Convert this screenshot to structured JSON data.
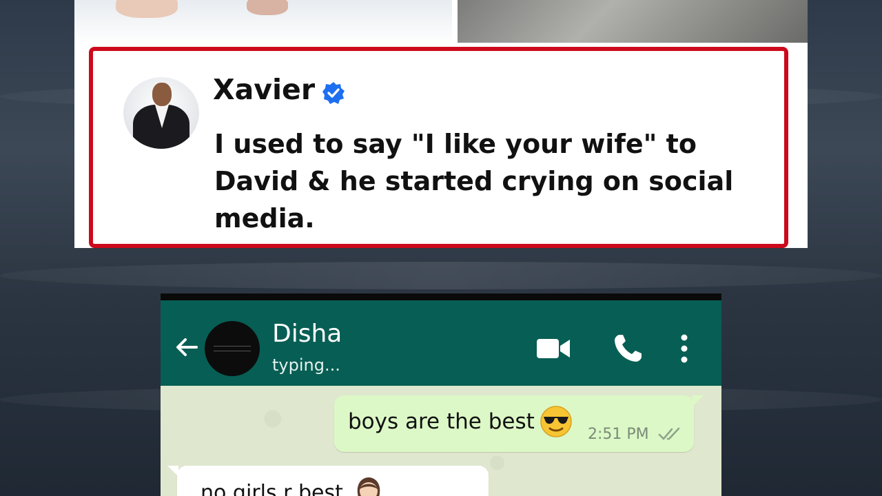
{
  "post": {
    "author": "Xavier",
    "verified": true,
    "text": "I used to say \"I like your wife\" to David & he started crying on social media.",
    "border_color": "#cc0a1c",
    "verified_color": "#1d6ff0"
  },
  "chat": {
    "contact_name": "Disha",
    "contact_status": "typing...",
    "header_color": "#075e54",
    "messages": [
      {
        "direction": "outgoing",
        "text": "boys are the best",
        "emoji": "smiling-face-with-sunglasses",
        "time": "2:51 PM",
        "status": "read-double-check"
      },
      {
        "direction": "incoming",
        "text": "no girls r best",
        "emoji": "woman-emoji"
      }
    ],
    "icons": [
      "back-arrow-icon",
      "video-call-icon",
      "phone-call-icon",
      "more-options-icon"
    ]
  }
}
